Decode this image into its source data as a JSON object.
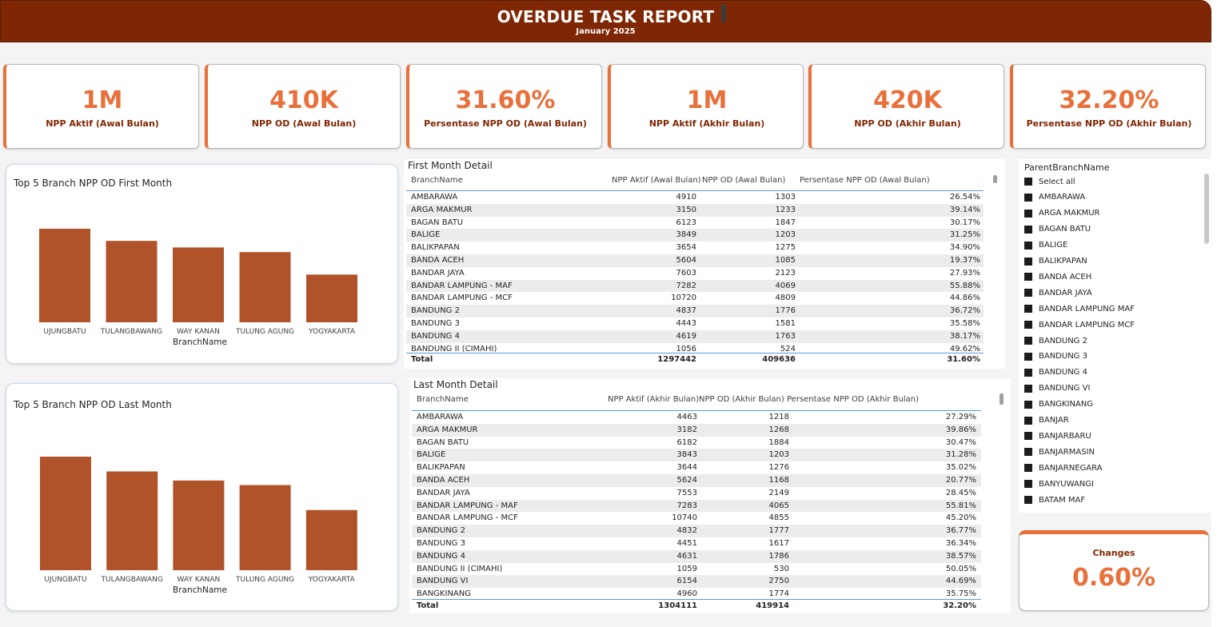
{
  "header": {
    "title": "OVERDUE TASK REPORT",
    "subtitle": "January 2025"
  },
  "kpis": [
    {
      "value": "1M",
      "label": "NPP Aktif (Awal Bulan)"
    },
    {
      "value": "410K",
      "label": "NPP OD (Awal Bulan)"
    },
    {
      "value": "31.60%",
      "label": "Persentase NPP OD (Awal Bulan)"
    },
    {
      "value": "1M",
      "label": "NPP Aktif (Akhir Bulan)"
    },
    {
      "value": "420K",
      "label": "NPP OD (Akhir Bulan)"
    },
    {
      "value": "32.20%",
      "label": "Persentase NPP OD (Akhir Bulan)"
    }
  ],
  "colors": {
    "header": "#7f2704",
    "accent": "#e8703a",
    "bar": "#b0532a"
  },
  "chart_first": {
    "title": "Top 5 Branch NPP OD First Month",
    "xlabel": "BranchName",
    "chart_data": {
      "type": "bar",
      "categories": [
        "UJUNGBATU",
        "TULANGBAWANG",
        "WAY KANAN",
        "TULUNG AGUNG",
        "YOGYAKARTA"
      ],
      "values": [
        100,
        87,
        80,
        75,
        51
      ],
      "ylim": [
        0,
        100
      ]
    }
  },
  "chart_last": {
    "title": "Top 5 Branch NPP OD Last Month",
    "xlabel": "BranchName",
    "chart_data": {
      "type": "bar",
      "categories": [
        "UJUNGBATU",
        "TULANGBAWANG",
        "WAY KANAN",
        "TULUNG AGUNG",
        "YOGYAKARTA"
      ],
      "values": [
        100,
        87,
        79,
        75,
        53
      ],
      "ylim": [
        0,
        100
      ]
    }
  },
  "first_table": {
    "title": "First Month Detail",
    "columns": [
      "BranchName",
      "NPP Aktif (Awal Bulan)",
      "NPP OD (Awal Bulan)",
      "Persentase NPP OD (Awal Bulan)"
    ],
    "rows": [
      [
        "AMBARAWA",
        "4910",
        "1303",
        "26.54%"
      ],
      [
        "ARGA MAKMUR",
        "3150",
        "1233",
        "39.14%"
      ],
      [
        "BAGAN BATU",
        "6123",
        "1847",
        "30.17%"
      ],
      [
        "BALIGE",
        "3849",
        "1203",
        "31.25%"
      ],
      [
        "BALIKPAPAN",
        "3654",
        "1275",
        "34.90%"
      ],
      [
        "BANDA ACEH",
        "5604",
        "1085",
        "19.37%"
      ],
      [
        "BANDAR JAYA",
        "7603",
        "2123",
        "27.93%"
      ],
      [
        "BANDAR LAMPUNG - MAF",
        "7282",
        "4069",
        "55.88%"
      ],
      [
        "BANDAR LAMPUNG - MCF",
        "10720",
        "4809",
        "44.86%"
      ],
      [
        "BANDUNG 2",
        "4837",
        "1776",
        "36.72%"
      ],
      [
        "BANDUNG 3",
        "4443",
        "1581",
        "35.58%"
      ],
      [
        "BANDUNG 4",
        "4619",
        "1763",
        "38.17%"
      ],
      [
        "BANDUNG II (CIMAHI)",
        "1056",
        "524",
        "49.62%"
      ]
    ],
    "total": [
      "Total",
      "1297442",
      "409636",
      "31.60%"
    ]
  },
  "last_table": {
    "title": "Last Month Detail",
    "columns": [
      "BranchName",
      "NPP Aktif (Akhir Bulan)",
      "NPP OD (Akhir Bulan)",
      "Persentase NPP OD (Akhir Bulan)"
    ],
    "rows": [
      [
        "AMBARAWA",
        "4463",
        "1218",
        "27.29%"
      ],
      [
        "ARGA MAKMUR",
        "3182",
        "1268",
        "39.86%"
      ],
      [
        "BAGAN BATU",
        "6182",
        "1884",
        "30.47%"
      ],
      [
        "BALIGE",
        "3843",
        "1203",
        "31.28%"
      ],
      [
        "BALIKPAPAN",
        "3644",
        "1276",
        "35.02%"
      ],
      [
        "BANDA ACEH",
        "5624",
        "1168",
        "20.77%"
      ],
      [
        "BANDAR JAYA",
        "7553",
        "2149",
        "28.45%"
      ],
      [
        "BANDAR LAMPUNG - MAF",
        "7283",
        "4065",
        "55.81%"
      ],
      [
        "BANDAR LAMPUNG - MCF",
        "10740",
        "4855",
        "45.20%"
      ],
      [
        "BANDUNG 2",
        "4832",
        "1777",
        "36.77%"
      ],
      [
        "BANDUNG 3",
        "4451",
        "1617",
        "36.34%"
      ],
      [
        "BANDUNG 4",
        "4631",
        "1786",
        "38.57%"
      ],
      [
        "BANDUNG II (CIMAHI)",
        "1059",
        "530",
        "50.05%"
      ],
      [
        "BANDUNG VI",
        "6154",
        "2750",
        "44.69%"
      ],
      [
        "BANGKINANG",
        "4960",
        "1774",
        "35.75%"
      ]
    ],
    "total": [
      "Total",
      "1304111",
      "419914",
      "32.20%"
    ]
  },
  "slicer": {
    "title": "ParentBranchName",
    "items": [
      "Select all",
      "AMBARAWA",
      "ARGA MAKMUR",
      "BAGAN BATU",
      "BALIGE",
      "BALIKPAPAN",
      "BANDA ACEH",
      "BANDAR JAYA",
      "BANDAR LAMPUNG MAF",
      "BANDAR LAMPUNG MCF",
      "BANDUNG 2",
      "BANDUNG 3",
      "BANDUNG 4",
      "BANDUNG VI",
      "BANGKINANG",
      "BANJAR",
      "BANJARBARU",
      "BANJARMASIN",
      "BANJARNEGARA",
      "BANYUWANGI",
      "BATAM MAF"
    ]
  },
  "changes": {
    "label": "Changes",
    "value": "0.60%"
  }
}
